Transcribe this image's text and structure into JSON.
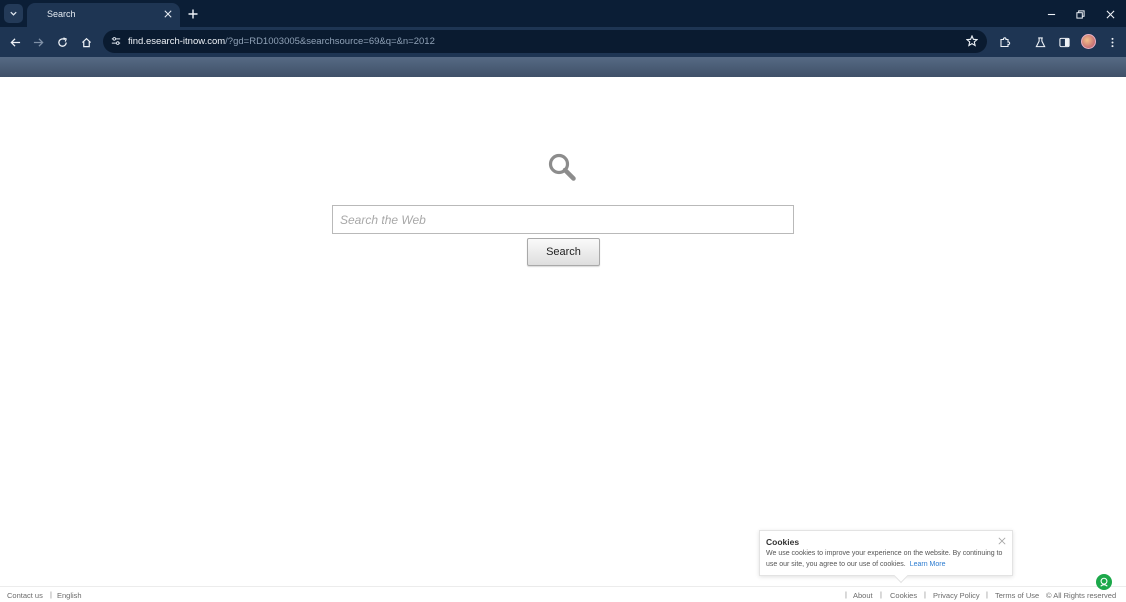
{
  "browser": {
    "tab_title": "Search",
    "url_host": "find.esearch-itnow.com",
    "url_path": "/?gd=RD1003005&searchsource=69&q=&n=2012"
  },
  "search": {
    "placeholder": "Search the Web",
    "value": "",
    "button_label": "Search"
  },
  "cookie": {
    "title": "Cookies",
    "text": "We use cookies to improve your experience on the website. By continuing to use our site, you agree to our use of cookies.",
    "link": "Learn More"
  },
  "footer": {
    "left": [
      "Contact us",
      "English"
    ],
    "right": [
      "About",
      "Cookies",
      "Privacy Policy",
      "Terms of Use",
      "© All Rights reserved"
    ]
  },
  "colors": {
    "tab_bar": "#0b1e36",
    "toolbar": "#1e3553",
    "link": "#2b7bd0",
    "help_badge": "#1ca84a"
  }
}
